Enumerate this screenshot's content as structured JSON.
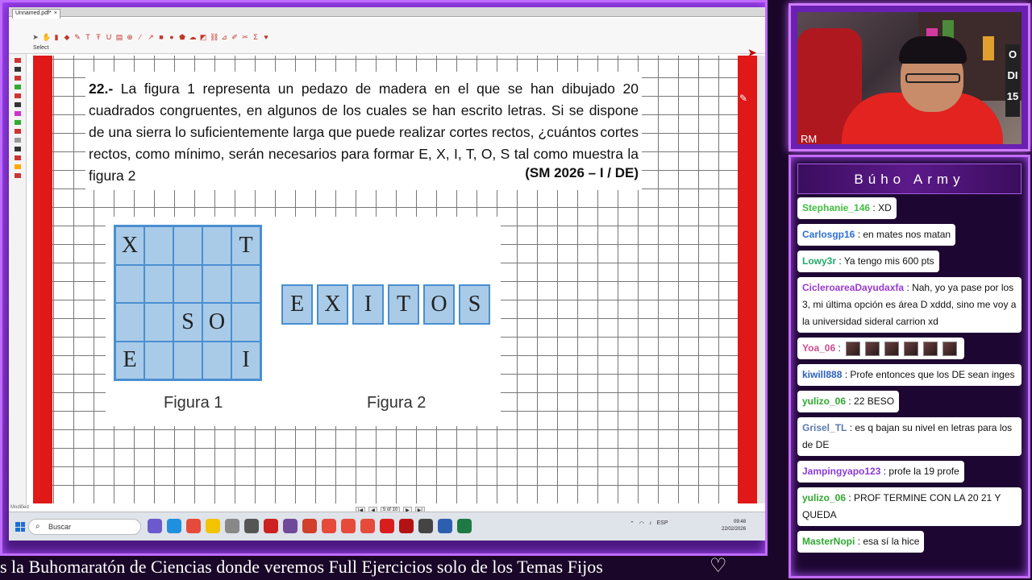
{
  "pdf_window": {
    "tab_label": "Unnamed.pdf*",
    "tab_close": "×",
    "select_label": "Select",
    "modified_label": "Modified",
    "pager": {
      "page_text": "5 of 10"
    }
  },
  "document": {
    "question_number": "22.-",
    "question_text": "La figura 1 representa un pedazo de madera en el que se han dibujado 20 cuadrados congruentes, en algunos de los cuales se han escrito letras. Si se dispone de una sierra lo suficientemente larga que puede realizar cortes rectos, ¿cuántos cortes rectos, como mínimo, serán necesarios para formar E, X, I, T, O, S tal como muestra la figura 2",
    "source": "(SM 2026 – I / DE)",
    "figure1": {
      "caption": "Figura 1",
      "grid": [
        [
          "X",
          "",
          "",
          "",
          "T"
        ],
        [
          "",
          "",
          "",
          "",
          ""
        ],
        [
          "",
          "",
          "S",
          "O",
          ""
        ],
        [
          "E",
          "",
          "",
          "",
          "I"
        ]
      ]
    },
    "figure2": {
      "caption": "Figura 2",
      "tiles": [
        "E",
        "X",
        "I",
        "T",
        "O",
        "S"
      ]
    }
  },
  "taskbar": {
    "search_placeholder": "Buscar",
    "language": "ESP",
    "time": "09:48",
    "date": "22/02/2026"
  },
  "webcam": {
    "overlay_text": "RM",
    "edge_text": [
      "O",
      "DI",
      "15"
    ]
  },
  "chat": {
    "title": "Búho Army",
    "messages": [
      {
        "user": "Stephanie_146",
        "user_color": "#3fbf3f",
        "text": "XD"
      },
      {
        "user": "Carlosgp16",
        "user_color": "#2e6fd8",
        "text": "en mates nos matan"
      },
      {
        "user": "Lowy3r",
        "user_color": "#24a86a",
        "text": "Ya tengo mis 600 pts"
      },
      {
        "user": "CicleroareaDayudaxfa",
        "user_color": "#9a3ad0",
        "text": "Nah, yo ya pase por los 3, mi última opción es área D xddd, sino me voy a la universidad sideral carrion xd"
      },
      {
        "user": "Yoa_06",
        "user_color": "#d04a8a",
        "text": ""
      },
      {
        "user": "kiwill888",
        "user_color": "#2a5fc0",
        "text": "Profe entonces que los DE sean inges"
      },
      {
        "user": "yulizo_06",
        "user_color": "#2fa830",
        "text": "22 BESO"
      },
      {
        "user": "Grisel_TL",
        "user_color": "#5a7ab0",
        "text": "es q bajan su nivel en letras para los de DE"
      },
      {
        "user": "Jampingyapo123",
        "user_color": "#8a3ad8",
        "text": "profe la 19 profe"
      },
      {
        "user": "yulizo_06",
        "user_color": "#2fa830",
        "text": "PROF TERMINE CON LA 20 21 Y QUEDA"
      },
      {
        "user": "MasterNopi",
        "user_color": "#2fa830",
        "text": "esa sí la hice"
      }
    ]
  },
  "ticker": {
    "text": "s la Buhomaratón de Ciencias donde veremos Full Ejercicios solo de los Temas Fijos",
    "heart": "♡"
  }
}
